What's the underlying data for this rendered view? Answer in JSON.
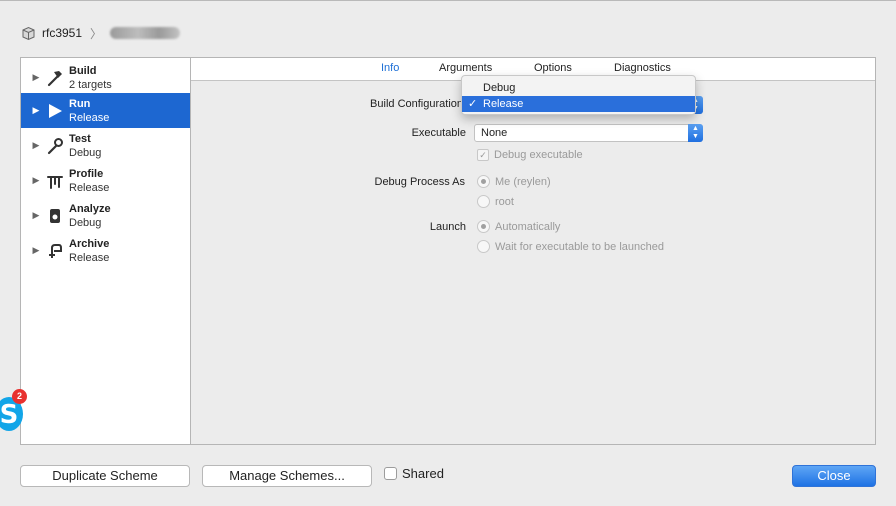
{
  "breadcrumb": {
    "project": "rfc3951"
  },
  "sidebar": {
    "items": [
      {
        "title": "Build",
        "subtitle": "2 targets"
      },
      {
        "title": "Run",
        "subtitle": "Release"
      },
      {
        "title": "Test",
        "subtitle": "Debug"
      },
      {
        "title": "Profile",
        "subtitle": "Release"
      },
      {
        "title": "Analyze",
        "subtitle": "Debug"
      },
      {
        "title": "Archive",
        "subtitle": "Release"
      }
    ]
  },
  "tabs": [
    "Info",
    "Arguments",
    "Options",
    "Diagnostics"
  ],
  "form": {
    "build_configuration_label": "Build Configuration",
    "executable_label": "Executable",
    "executable_value": "None",
    "debug_executable_label": "Debug executable",
    "debug_process_as_label": "Debug Process As",
    "process_me": "Me (reylen)",
    "process_root": "root",
    "launch_label": "Launch",
    "launch_auto": "Automatically",
    "launch_wait": "Wait for executable to be launched"
  },
  "dropdown": {
    "options": [
      "Debug",
      "Release"
    ],
    "selected": "Release",
    "checkmark": "✓"
  },
  "footer": {
    "duplicate_label": "Duplicate Scheme",
    "manage_label": "Manage Schemes...",
    "shared_label": "Shared",
    "close_label": "Close"
  },
  "skype": {
    "badge": "2",
    "letter": "S"
  },
  "colors": {
    "accent": "#1d67d1",
    "tab_active": "#1d6fd6"
  }
}
